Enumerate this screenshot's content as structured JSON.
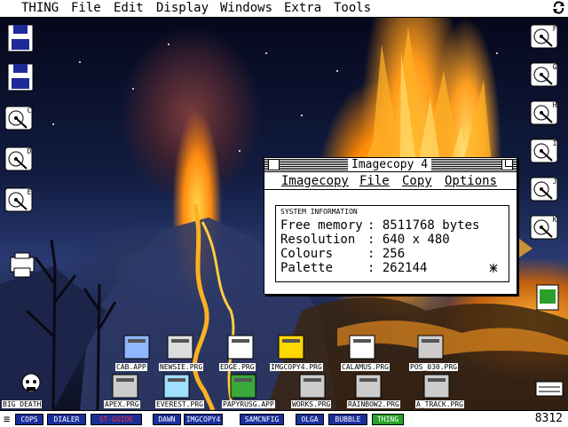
{
  "menubar": {
    "app": "THING",
    "items": [
      "File",
      "Edit",
      "Display",
      "Windows",
      "Extra",
      "Tools"
    ]
  },
  "window": {
    "title": "Imagecopy 4",
    "menus": [
      "Imagecopy",
      "File",
      "Copy",
      "Options"
    ],
    "group_label": "SYSTEM INFORMATION",
    "rows": [
      {
        "key": "Free memory",
        "value": "8511768 bytes"
      },
      {
        "key": "Resolution",
        "value": "640 x 480"
      },
      {
        "key": "Colours",
        "value": "256"
      },
      {
        "key": "Palette",
        "value": "262144"
      }
    ]
  },
  "desktop": {
    "left_drives": [
      "C",
      "D",
      "E"
    ],
    "right_drives": [
      "F",
      "G",
      "H",
      "I",
      "J",
      "K"
    ],
    "programs_row1": [
      "CAB.APP",
      "NEWSIE.PRG",
      "EDGE.PRG",
      "IMGCOPY4.PRG",
      "CALAMUS.PRG",
      "POS_030.PRG"
    ],
    "programs_row2": [
      "APEX.PRG",
      "EVEREST.PRG",
      "PAPYRUSG.APP",
      "WORKS.PRG",
      "RAINBOW2.PRG",
      "A_TRACK.PRG"
    ],
    "trash_label": "BIG DEATH"
  },
  "taskbar": {
    "menu_glyph": "≡",
    "buttons": [
      "COPS",
      "DIALER",
      "ST-GUIDE",
      "DAWN",
      "IMGCOPY4",
      "SAMCNFIG",
      "OLGA",
      "BUBBLE",
      "THING"
    ],
    "clock": "8312"
  },
  "colors": {
    "taskbar_button": "#1a2e9a",
    "taskbar_active": "#2aa02a",
    "taskbar_alert": "#ff3030"
  }
}
